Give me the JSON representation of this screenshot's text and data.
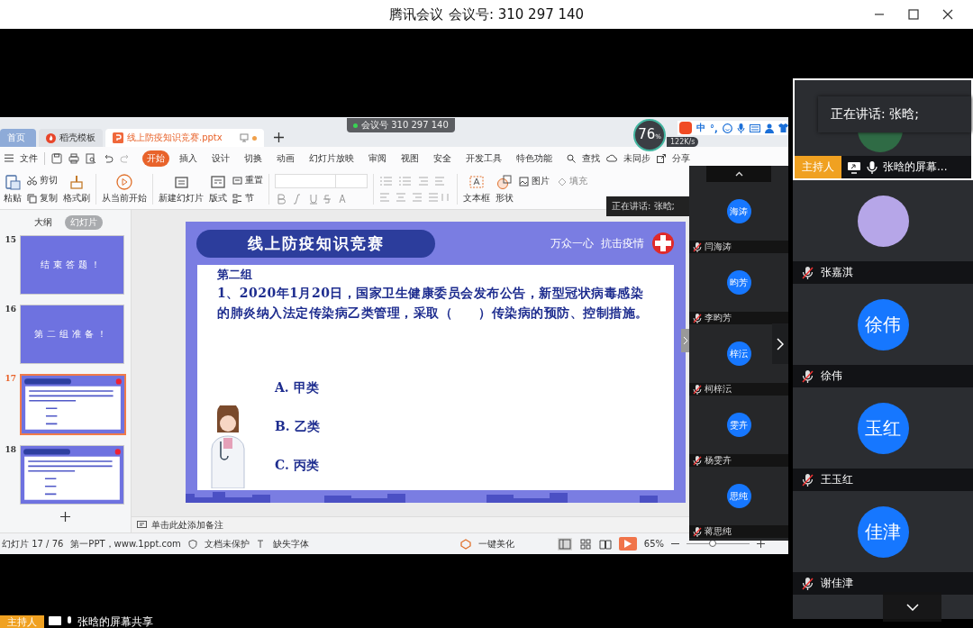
{
  "meeting_window": {
    "app_name": "腾讯会议",
    "meeting_number": "会议号: 310 297 140"
  },
  "wps": {
    "tabs": [
      {
        "label": "首页",
        "kind": "home",
        "selected": false
      },
      {
        "label": "稻壳模板",
        "kind": "docer",
        "selected": false
      },
      {
        "label": "线上防疫知识竞赛.pptx",
        "kind": "document",
        "selected": true
      }
    ],
    "meeting_badge": "会议号 310 297 140",
    "file_menu": "文件",
    "menu": [
      {
        "label": "开始",
        "selected": true
      },
      {
        "label": "插入",
        "selected": false
      },
      {
        "label": "设计",
        "selected": false
      },
      {
        "label": "切换",
        "selected": false
      },
      {
        "label": "动画",
        "selected": false
      },
      {
        "label": "幻灯片放映",
        "selected": false
      },
      {
        "label": "审阅",
        "selected": false
      },
      {
        "label": "视图",
        "selected": false
      },
      {
        "label": "安全",
        "selected": false
      },
      {
        "label": "开发工具",
        "selected": false
      },
      {
        "label": "特色功能",
        "selected": false
      }
    ],
    "search": "查找",
    "sync": "未同步",
    "share": "分享",
    "ribbon": {
      "paste": "粘贴",
      "cut": "剪切",
      "copy": "复制",
      "format_painter": "格式刷",
      "play_from_current": "从当前开始",
      "new_slide": "新建幻灯片",
      "layout": "版式",
      "reset": "重置",
      "section": "节",
      "text_box": "文本框",
      "shape": "形状",
      "picture": "图片",
      "fill": "填充"
    },
    "pane_tabs": [
      {
        "label": "大纲",
        "selected": false
      },
      {
        "label": "幻灯片",
        "selected": true
      }
    ],
    "thumbnails": [
      {
        "number": "15",
        "kind": "title",
        "text": "结束答题！",
        "selected": false
      },
      {
        "number": "16",
        "kind": "title",
        "text": "第二组准备！",
        "selected": false
      },
      {
        "number": "17",
        "kind": "question",
        "selected": true
      },
      {
        "number": "18",
        "kind": "question",
        "selected": false
      }
    ],
    "slide": {
      "title": "线上防疫知识竞赛",
      "slogan": "万众一心  抗击疫情",
      "group": "第二组",
      "question": "1、2020年1月20日，国家卫生健康委员会发布公告，新型冠状病毒感染的肺炎纳入法定传染病乙类管理，采取（　　）传染病的预防、控制措施。",
      "options": [
        "A. 甲类",
        "B. 乙类",
        "C. 丙类"
      ]
    },
    "notes_placeholder": "单击此处添加备注",
    "status": {
      "slide_count": "幻灯片 17 / 76",
      "theme": "第一PPT，www.1ppt.com",
      "protection": "文档未保护",
      "missing_fonts": "缺失字体",
      "beautify": "一键美化",
      "zoom": "65%",
      "zoom_slider": {
        "level": 0.42
      }
    }
  },
  "speed_widget": {
    "percent": "76",
    "unit": "%",
    "rate": "122K/s"
  },
  "ime": {
    "mode": "中",
    "punctuation": "°,"
  },
  "strip_tooltip": "正在讲话: 张晗;",
  "participant_strip": [
    {
      "avatar": "海涛",
      "name": "闫海涛",
      "muted": true
    },
    {
      "avatar": "昀芳",
      "name": "李昀芳",
      "muted": true
    },
    {
      "avatar": "梓沄",
      "name": "柯梓沄",
      "muted": true
    },
    {
      "avatar": "雯卉",
      "name": "杨雯卉",
      "muted": true
    },
    {
      "avatar": "思纯",
      "name": "蒋思纯",
      "muted": true
    }
  ],
  "gallery": {
    "host": {
      "speaking": "正在讲话: 张晗;",
      "badge": "主持人",
      "name": "张晗的屏幕...",
      "muted": false
    },
    "participants": [
      {
        "kind": "photo",
        "name": "张嘉淇",
        "muted": true
      },
      {
        "kind": "initials",
        "avatar": "徐伟",
        "name": "徐伟",
        "muted": true
      },
      {
        "kind": "initials",
        "avatar": "玉红",
        "name": "王玉红",
        "muted": true
      },
      {
        "kind": "initials",
        "avatar": "佳津",
        "name": "谢佳津",
        "muted": true
      }
    ]
  },
  "share_caption": {
    "badge": "主持人",
    "text": "张晗的屏幕共享"
  }
}
